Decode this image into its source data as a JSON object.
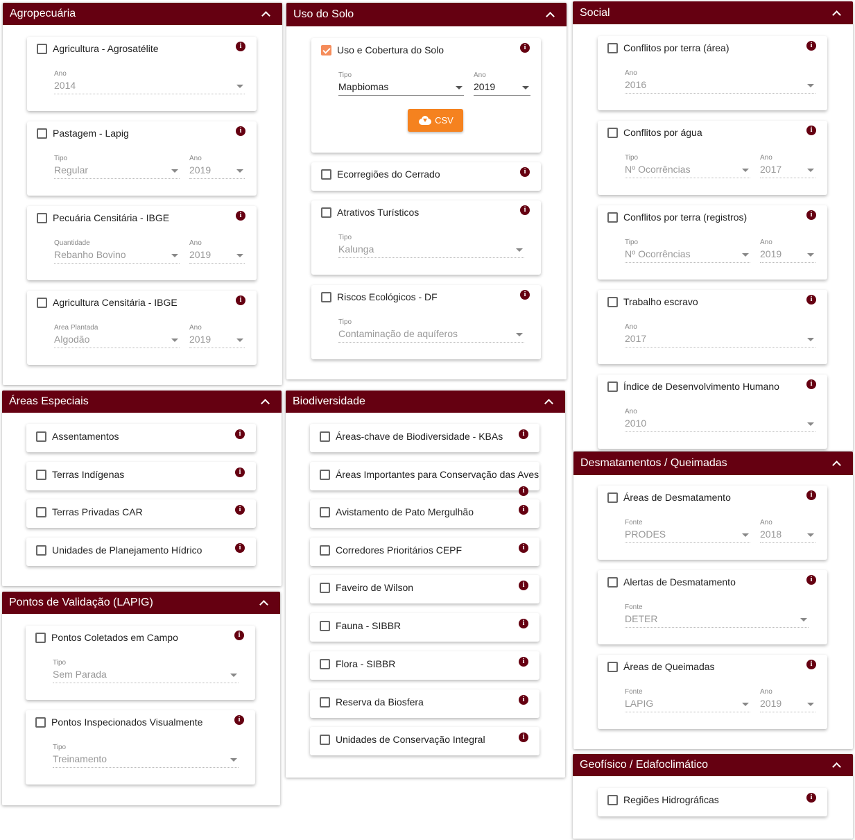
{
  "panels": {
    "agropecuaria": {
      "title": "Agropecuária",
      "cards": [
        {
          "label": "Agricultura - Agrosatélite",
          "ano_label": "Ano",
          "ano": "2014"
        },
        {
          "label": "Pastagem - Lapig",
          "tipo_label": "Tipo",
          "tipo": "Regular",
          "ano_label": "Ano",
          "ano": "2019"
        },
        {
          "label": "Pecuária Censitária - IBGE",
          "tipo_label": "Quantidade",
          "tipo": "Rebanho Bovino",
          "ano_label": "Ano",
          "ano": "2019"
        },
        {
          "label": "Agricultura Censitária - IBGE",
          "tipo_label": "Area Plantada",
          "tipo": "Algodão",
          "ano_label": "Ano",
          "ano": "2019"
        }
      ]
    },
    "uso_solo": {
      "title": "Uso do Solo",
      "cards": [
        {
          "label": "Uso e Cobertura do Solo",
          "checked": true,
          "tipo_label": "Tipo",
          "tipo": "Mapbiomas",
          "ano_label": "Ano",
          "ano": "2019",
          "csv": "CSV"
        },
        {
          "label": "Ecorregiões do Cerrado"
        },
        {
          "label": "Atrativos Turísticos",
          "tipo_label": "Tipo",
          "tipo": "Kalunga"
        },
        {
          "label": "Riscos Ecológicos - DF",
          "tipo_label": "Tipo",
          "tipo": "Contaminação de aquíferos"
        }
      ]
    },
    "social": {
      "title": "Social",
      "cards": [
        {
          "label": "Conflitos por terra (área)",
          "ano_label": "Ano",
          "ano": "2016"
        },
        {
          "label": "Conflitos por água",
          "tipo_label": "Tipo",
          "tipo": "Nº Ocorrências",
          "ano_label": "Ano",
          "ano": "2017"
        },
        {
          "label": "Conflitos por terra (registros)",
          "tipo_label": "Tipo",
          "tipo": "Nº Ocorrências",
          "ano_label": "Ano",
          "ano": "2019"
        },
        {
          "label": "Trabalho escravo",
          "ano_label": "Ano",
          "ano": "2017"
        },
        {
          "label": "Índice de Desenvolvimento Humano",
          "ano_label": "Ano",
          "ano": "2010"
        }
      ]
    },
    "areas_especiais": {
      "title": "Áreas Especiais",
      "cards": [
        {
          "label": "Assentamentos"
        },
        {
          "label": "Terras Indígenas"
        },
        {
          "label": "Terras Privadas CAR"
        },
        {
          "label": "Unidades de Planejamento Hídrico"
        }
      ]
    },
    "biodiversidade": {
      "title": "Biodiversidade",
      "cards": [
        {
          "label": "Áreas-chave de Biodiversidade - KBAs"
        },
        {
          "label": "Áreas Importantes para Conservação das Aves"
        },
        {
          "label": "Avistamento de Pato Mergulhão"
        },
        {
          "label": "Corredores Prioritários CEPF"
        },
        {
          "label": "Faveiro de Wilson"
        },
        {
          "label": "Fauna - SIBBR"
        },
        {
          "label": "Flora - SIBBR"
        },
        {
          "label": "Reserva da Biosfera"
        },
        {
          "label": "Unidades de Conservação Integral"
        }
      ]
    },
    "pontos": {
      "title": "Pontos de Validação (LAPIG)",
      "cards": [
        {
          "label": "Pontos Coletados em Campo",
          "tipo_label": "Tipo",
          "tipo": "Sem Parada"
        },
        {
          "label": "Pontos Inspecionados Visualmente",
          "tipo_label": "Tipo",
          "tipo": "Treinamento"
        }
      ]
    },
    "desmatamentos": {
      "title": "Desmatamentos / Queimadas",
      "cards": [
        {
          "label": "Áreas de Desmatamento",
          "tipo_label": "Fonte",
          "tipo": "PRODES",
          "ano_label": "Ano",
          "ano": "2018"
        },
        {
          "label": "Alertas de Desmatamento",
          "tipo_label": "Fonte",
          "tipo": "DETER"
        },
        {
          "label": "Áreas de Queimadas",
          "tipo_label": "Fonte",
          "tipo": "LAPIG",
          "ano_label": "Ano",
          "ano": "2019"
        }
      ]
    },
    "geofisico": {
      "title": "Geofísico / Edafoclimático",
      "cards": [
        {
          "label": "Regiões Hidrográficas"
        }
      ]
    }
  },
  "info_icon": "info-icon",
  "colors": {
    "header": "#650011",
    "accent": "#f58c5a",
    "csv_button": "#f5821f"
  }
}
